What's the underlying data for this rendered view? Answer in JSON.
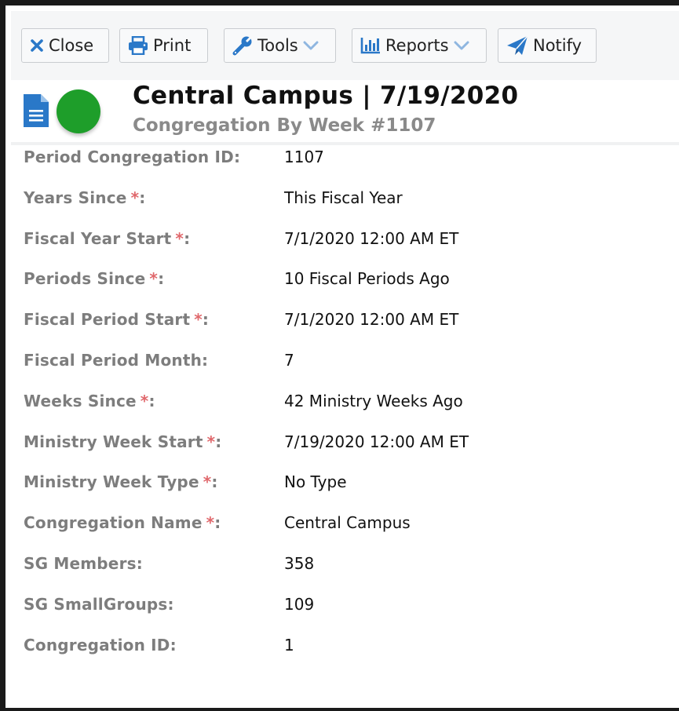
{
  "toolbar": {
    "close_label": "Close",
    "print_label": "Print",
    "tools_label": "Tools",
    "reports_label": "Reports",
    "notify_label": "Notify"
  },
  "header": {
    "title": "Central Campus | 7/19/2020",
    "subtitle": "Congregation By Week #1107",
    "status_color": "#1e9e2a"
  },
  "fields": [
    {
      "label": "Period Congregation ID",
      "required": false,
      "value": "1107"
    },
    {
      "label": "Years Since",
      "required": true,
      "value": "This Fiscal Year"
    },
    {
      "label": "Fiscal Year Start",
      "required": true,
      "value": "7/1/2020 12:00 AM ET"
    },
    {
      "label": "Periods Since",
      "required": true,
      "value": "10 Fiscal Periods Ago"
    },
    {
      "label": "Fiscal Period Start",
      "required": true,
      "value": "7/1/2020 12:00 AM ET"
    },
    {
      "label": "Fiscal Period Month",
      "required": false,
      "value": "7"
    },
    {
      "label": "Weeks Since",
      "required": true,
      "value": "42 Ministry Weeks Ago"
    },
    {
      "label": "Ministry Week Start",
      "required": true,
      "value": "7/19/2020 12:00 AM ET"
    },
    {
      "label": "Ministry Week Type",
      "required": true,
      "value": "No Type"
    },
    {
      "label": "Congregation Name",
      "required": true,
      "value": "Central Campus"
    },
    {
      "label": "SG Members",
      "required": false,
      "value": "358"
    },
    {
      "label": "SG SmallGroups",
      "required": false,
      "value": "109"
    },
    {
      "label": "Congregation ID",
      "required": false,
      "value": "1"
    }
  ]
}
